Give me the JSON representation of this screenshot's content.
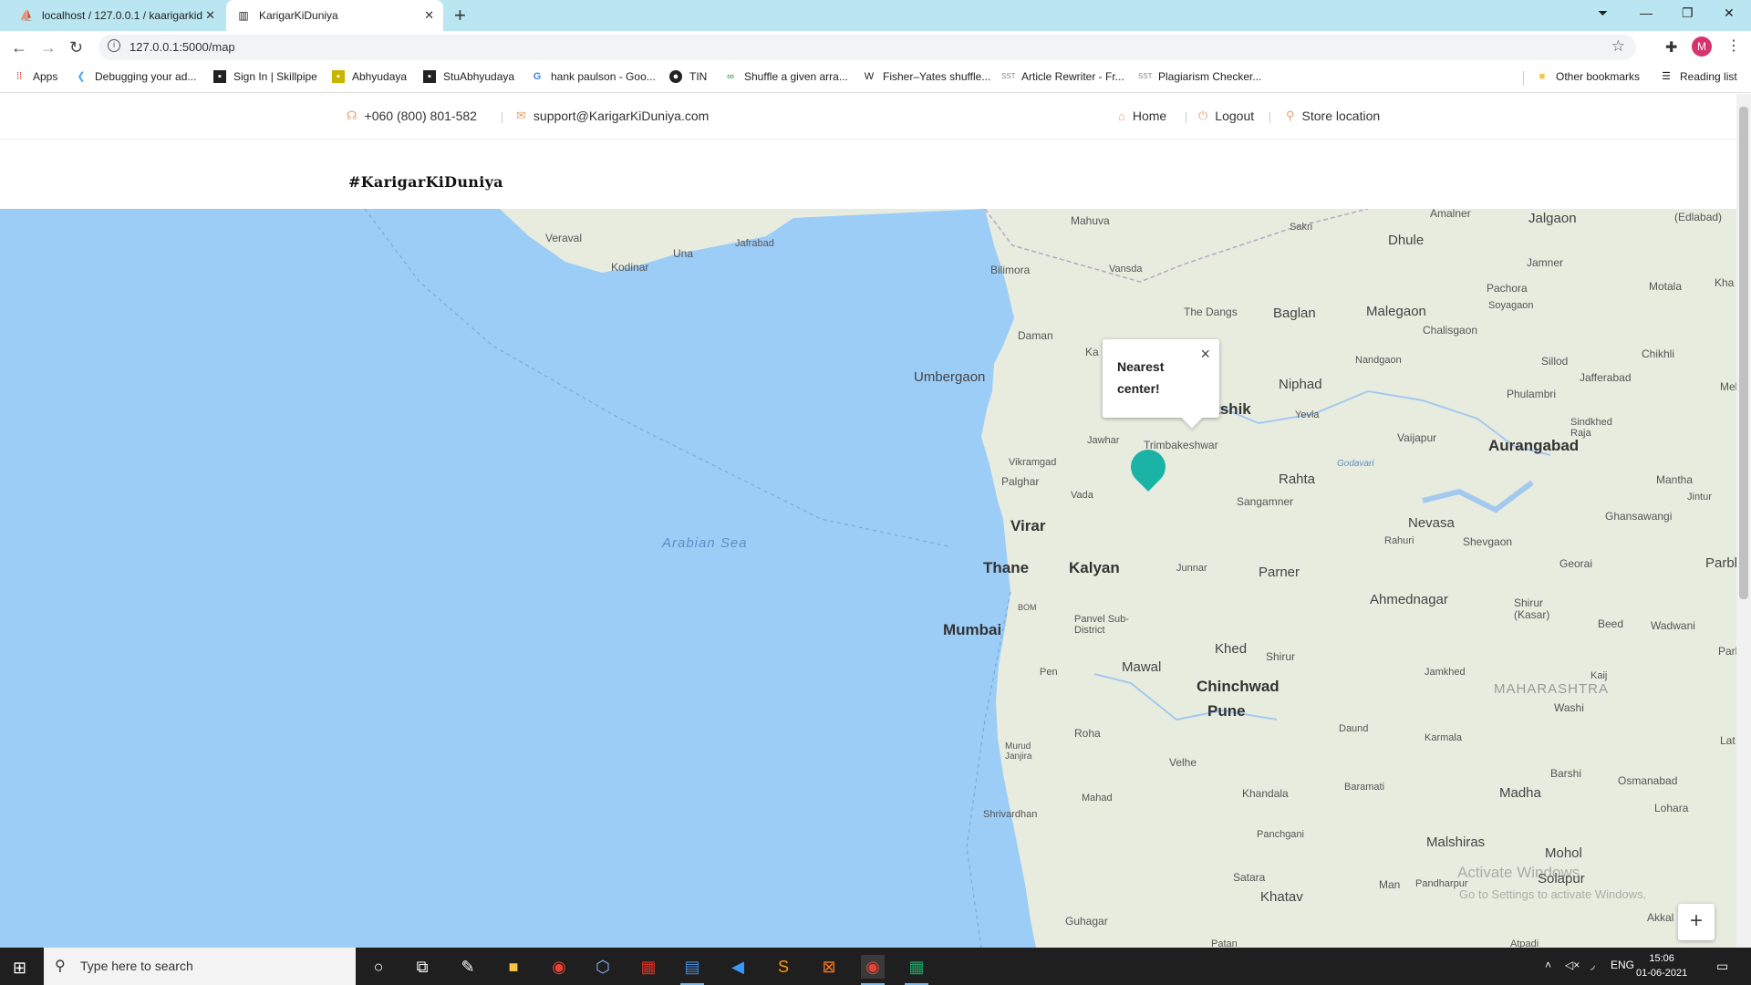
{
  "browser": {
    "tabs": [
      {
        "title": "localhost / 127.0.0.1 / kaarigarkid",
        "active": false
      },
      {
        "title": "KarigarKiDuniya",
        "active": true
      }
    ],
    "new_tab_label": "+",
    "url": "127.0.0.1:5000/map",
    "profile_initial": "M",
    "bookmarks": [
      {
        "label": "Apps",
        "icon": "apps-grid-icon"
      },
      {
        "label": "Debugging your ad...",
        "icon": "flutter-icon"
      },
      {
        "label": "Sign In | Skillpipe",
        "icon": "skillpipe-icon"
      },
      {
        "label": "Abhyudaya",
        "icon": "abhyudaya-icon"
      },
      {
        "label": "StuAbhyudaya",
        "icon": "stuabhyudaya-icon"
      },
      {
        "label": "hank paulson - Goo...",
        "icon": "google-icon"
      },
      {
        "label": "TIN",
        "icon": "tin-icon"
      },
      {
        "label": "Shuffle a given arra...",
        "icon": "geeks-icon"
      },
      {
        "label": "Fisher–Yates shuffle...",
        "icon": "wikipedia-icon"
      },
      {
        "label": "Article Rewriter - Fr...",
        "icon": "sst-icon"
      },
      {
        "label": "Plagiarism Checker...",
        "icon": "sst-icon"
      }
    ],
    "other_bookmarks": "Other bookmarks",
    "reading_list": "Reading list"
  },
  "site": {
    "phone": "+060 (800) 801-582",
    "email": "support@KarigarKiDuniya.com",
    "nav": [
      {
        "label": "Home",
        "icon": "home-icon"
      },
      {
        "label": "Logout",
        "icon": "power-icon"
      },
      {
        "label": "Store location",
        "icon": "location-pin-icon"
      }
    ],
    "brand": "#KarigarKiDuniya"
  },
  "map": {
    "popup_text": "Nearest center!",
    "popup_close": "×",
    "zoom_in_label": "+",
    "sea_label": "Arabian Sea",
    "state_label": "MAHARASHTRA",
    "colors": {
      "sea": "#9ccdf7",
      "land": "#e8ecdf",
      "marker": "#1ab3a6"
    },
    "places": [
      {
        "name": "Veraval"
      },
      {
        "name": "Kodinar"
      },
      {
        "name": "Una"
      },
      {
        "name": "Jafrabad"
      },
      {
        "name": "Mahuva"
      },
      {
        "name": "Sakri"
      },
      {
        "name": "Amalner"
      },
      {
        "name": "Jalgaon"
      },
      {
        "name": "(Edlabad)"
      },
      {
        "name": "Dhule"
      },
      {
        "name": "Bilimora"
      },
      {
        "name": "Vansda"
      },
      {
        "name": "Jamner"
      },
      {
        "name": "Pachora"
      },
      {
        "name": "Motala"
      },
      {
        "name": "Kha"
      },
      {
        "name": "The Dangs"
      },
      {
        "name": "Baglan"
      },
      {
        "name": "Malegaon"
      },
      {
        "name": "Soyagaon"
      },
      {
        "name": "Daman"
      },
      {
        "name": "Chalisgaon"
      },
      {
        "name": "Ka"
      },
      {
        "name": "Chikhli"
      },
      {
        "name": "Nandgaon"
      },
      {
        "name": "Sillod"
      },
      {
        "name": "Umbergaon"
      },
      {
        "name": "Jafferabad"
      },
      {
        "name": "Mel"
      },
      {
        "name": "Niphad"
      },
      {
        "name": "Phulambri"
      },
      {
        "name": "Yevla"
      },
      {
        "name": "Nashik"
      },
      {
        "name": "Sindkhed Raja"
      },
      {
        "name": "Jawhar"
      },
      {
        "name": "Trimbakeshwar"
      },
      {
        "name": "Vaijapur"
      },
      {
        "name": "Aurangabad"
      },
      {
        "name": "Vikramgad"
      },
      {
        "name": "Godavari"
      },
      {
        "name": "Palghar"
      },
      {
        "name": "Rahta"
      },
      {
        "name": "Mantha"
      },
      {
        "name": "Vada"
      },
      {
        "name": "Jintur"
      },
      {
        "name": "Sangamner"
      },
      {
        "name": "Ghansawangi"
      },
      {
        "name": "Nevasa"
      },
      {
        "name": "Virar"
      },
      {
        "name": "Rahuri"
      },
      {
        "name": "Shevgaon"
      },
      {
        "name": "Georai"
      },
      {
        "name": "Parbha"
      },
      {
        "name": "Thane"
      },
      {
        "name": "Kalyan"
      },
      {
        "name": "Junnar"
      },
      {
        "name": "Parner"
      },
      {
        "name": "BOM"
      },
      {
        "name": "Ahmednagar"
      },
      {
        "name": "Shirur (Kasar)"
      },
      {
        "name": "Panvel Sub-District"
      },
      {
        "name": "Beed"
      },
      {
        "name": "Wadwani"
      },
      {
        "name": "Mumbai"
      },
      {
        "name": "Khed"
      },
      {
        "name": "Shirur"
      },
      {
        "name": "Parli"
      },
      {
        "name": "Mawal"
      },
      {
        "name": "Pen"
      },
      {
        "name": "Jamkhed"
      },
      {
        "name": "Kaij"
      },
      {
        "name": "Chinchwad"
      },
      {
        "name": "Washi"
      },
      {
        "name": "Pune"
      },
      {
        "name": "Roha"
      },
      {
        "name": "Daund"
      },
      {
        "name": "Karmala"
      },
      {
        "name": "Lat"
      },
      {
        "name": "Murud Janjira"
      },
      {
        "name": "Velhe"
      },
      {
        "name": "Barshi"
      },
      {
        "name": "Osmanabad"
      },
      {
        "name": "Baramati"
      },
      {
        "name": "Mahad"
      },
      {
        "name": "Khandala"
      },
      {
        "name": "Madha"
      },
      {
        "name": "Shrivardhan"
      },
      {
        "name": "Lohara"
      },
      {
        "name": "Panchgani"
      },
      {
        "name": "Malshiras"
      },
      {
        "name": "Mohol"
      },
      {
        "name": "Satara"
      },
      {
        "name": "Solapur"
      },
      {
        "name": "Man"
      },
      {
        "name": "Pandharpur"
      },
      {
        "name": "Khatav"
      },
      {
        "name": "Guhagar"
      },
      {
        "name": "Akkal"
      },
      {
        "name": "Patan"
      },
      {
        "name": "Atpadi"
      }
    ]
  },
  "watermark": {
    "line1": "Activate Windows",
    "line2": "Go to Settings to activate Windows."
  },
  "taskbar": {
    "search_placeholder": "Type here to search",
    "apps": [
      "cortana-icon",
      "task-view-icon",
      "paint-icon",
      "file-explorer-icon",
      "chrome-icon",
      "virtualbox-icon",
      "app-icon",
      "word-icon",
      "vscode-icon",
      "sublime-icon",
      "xampp-icon",
      "chrome-active-icon",
      "excel-icon"
    ],
    "lang": "ENG",
    "time": "15:06",
    "date": "01-06-2021"
  }
}
